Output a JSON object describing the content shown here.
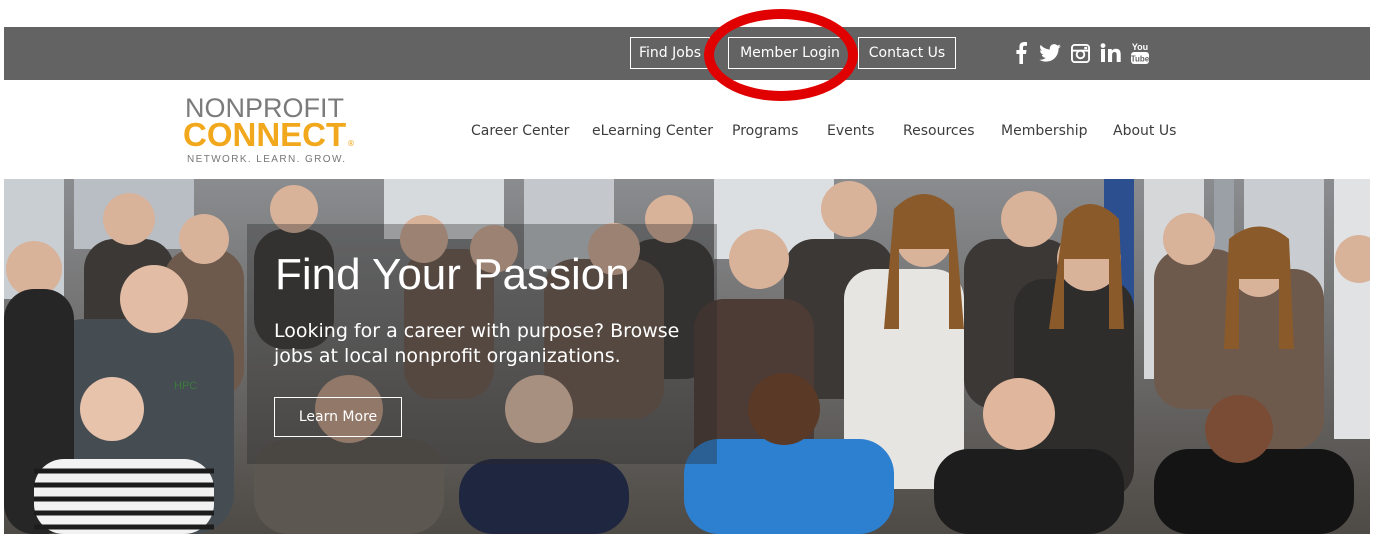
{
  "topbar": {
    "buttons": {
      "find_jobs": "Find Jobs",
      "member_login": "Member Login",
      "contact_us": "Contact Us"
    },
    "social_icons": [
      "facebook-icon",
      "twitter-icon",
      "instagram-icon",
      "linkedin-icon",
      "youtube-icon"
    ],
    "youtube_lines": [
      "You",
      "Tube"
    ]
  },
  "logo": {
    "line1": "NONPROFIT",
    "line2": "CONNECT",
    "reg": "®",
    "tagline": "NETWORK. LEARN. GROW."
  },
  "nav": {
    "items": [
      "Career Center",
      "eLearning Center",
      "Programs",
      "Events",
      "Resources",
      "Membership",
      "About Us"
    ]
  },
  "hero": {
    "title": "Find Your Passion",
    "text": "Looking for a career with purpose? Browse jobs at local nonprofit organizations.",
    "button": "Learn More",
    "shirt_text": "HPC"
  },
  "colors": {
    "topbar_bg": "#636363",
    "logo_orange": "#f2a81d",
    "logo_gray": "#7b7b7b",
    "highlight_red": "#e10000",
    "nav_text": "#3d3d3d"
  }
}
